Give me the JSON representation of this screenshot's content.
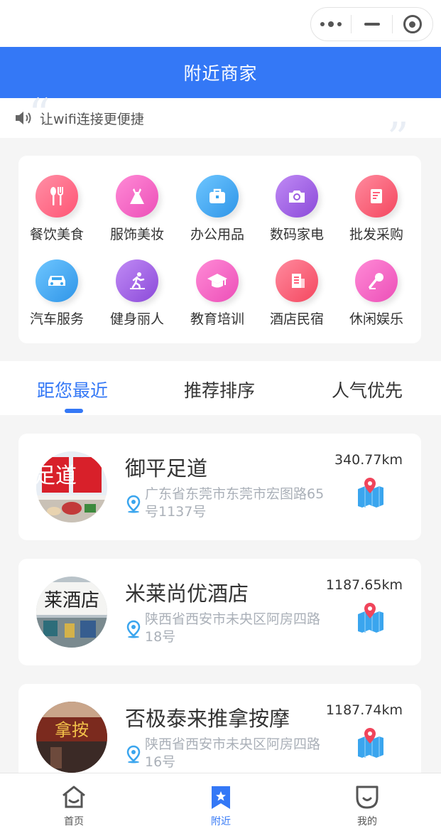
{
  "header": {
    "title": "附近商家"
  },
  "notice": {
    "text": "让wifi连接更便捷"
  },
  "categories": [
    {
      "label": "餐饮美食",
      "icon": "fork-knife-icon",
      "color": "#ff6b8a"
    },
    {
      "label": "服饰美妆",
      "icon": "dress-icon",
      "color": "#f45fc3"
    },
    {
      "label": "办公用品",
      "icon": "briefcase-icon",
      "color": "#3aa5ee"
    },
    {
      "label": "数码家电",
      "icon": "camera-icon",
      "color": "#9b5ae0"
    },
    {
      "label": "批发采购",
      "icon": "receipt-icon",
      "color": "#ff5f7a"
    },
    {
      "label": "汽车服务",
      "icon": "car-icon",
      "color": "#3aa5ee"
    },
    {
      "label": "健身丽人",
      "icon": "runner-icon",
      "color": "#9b5ae0"
    },
    {
      "label": "教育培训",
      "icon": "graduation-cap-icon",
      "color": "#f45fc3"
    },
    {
      "label": "酒店民宿",
      "icon": "hotel-building-icon",
      "color": "#ff5f7a"
    },
    {
      "label": "休闲娱乐",
      "icon": "microphone-icon",
      "color": "#f45fc3"
    }
  ],
  "sort_tabs": [
    {
      "label": "距您最近",
      "active": true
    },
    {
      "label": "推荐排序",
      "active": false
    },
    {
      "label": "人气优先",
      "active": false
    }
  ],
  "merchants": [
    {
      "name": "御平足道",
      "address": "广东省东莞市东莞市宏图路65号1137号",
      "distance": "340.77km",
      "thumb_text": "足道"
    },
    {
      "name": "米莱尚优酒店",
      "address": "陕西省西安市未央区阿房四路18号",
      "distance": "1187.65km",
      "thumb_text": "莱酒店"
    },
    {
      "name": "否极泰来推拿按摩",
      "address": "陕西省西安市未央区阿房四路16号",
      "distance": "1187.74km",
      "thumb_text": "拿按"
    }
  ],
  "tabbar": {
    "items": [
      {
        "label": "首页",
        "icon": "home-icon"
      },
      {
        "label": "附近",
        "icon": "bookmark-star-icon"
      },
      {
        "label": "我的",
        "icon": "user-face-icon"
      }
    ]
  },
  "colors": {
    "primary": "#3478f6",
    "address": "#aab0b8",
    "map_pin": "#f0455b"
  }
}
